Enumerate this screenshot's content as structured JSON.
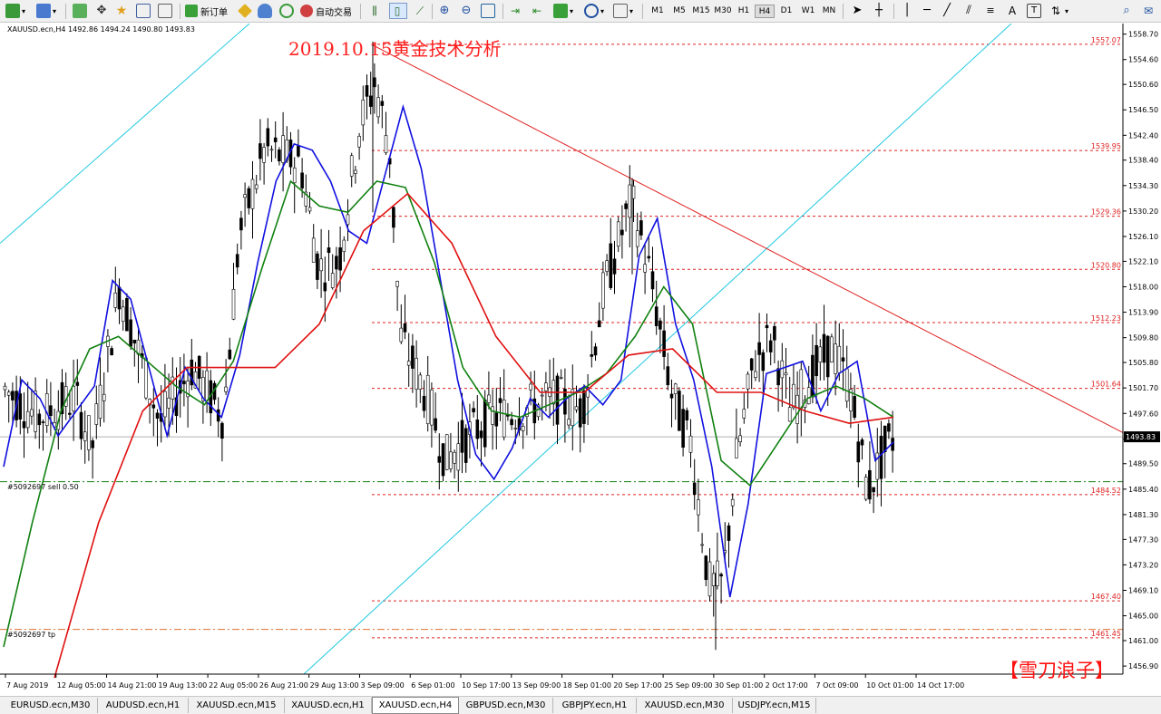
{
  "toolbar": {
    "new_order_label": "新订单",
    "auto_trading_label": "自动交易",
    "timeframes": [
      "M1",
      "M5",
      "M15",
      "M30",
      "H1",
      "H4",
      "D1",
      "W1",
      "MN"
    ],
    "active_timeframe": "H4"
  },
  "chart_header": {
    "symbol_info": "XAUUSD.ecn,H4  1492.86 1494.24 1490.80 1493.83"
  },
  "order_labels": {
    "sell_order": "#5092697 sell 0.50",
    "tp_order": "#5092697 tp"
  },
  "watermark": "【雪刀浪子】",
  "tabs": [
    "EURUSD.ecn,M30",
    "AUDUSD.ecn,H1",
    "XAUUSD.ecn,M15",
    "XAUUSD.ecn,H1",
    "XAUUSD.ecn,H4",
    "GBPUSD.ecn,M30",
    "GBPJPY.ecn,H1",
    "XAUUSD.ecn,M30",
    "USDJPY.ecn,M15"
  ],
  "active_tab": "XAUUSD.ecn,H4",
  "colors": {
    "bull_candle": "#ffffff",
    "bear_candle": "#000000",
    "ma_fast": "#1010e0",
    "ma_mid": "#108010",
    "ma_slow": "#e01010",
    "level_lines": "#e02020",
    "trend_channel": "#20c8e0",
    "resistance_trend": "#e02020",
    "order_line": "#108010",
    "tp_line": "#e07030"
  },
  "chart_data": {
    "type": "candlestick",
    "title": "2019.10.15黄金技术分析",
    "symbol": "XAUUSD.ecn",
    "timeframe": "H4",
    "last_price": 1493.83,
    "ylim": [
      1455.6,
      1560.4
    ],
    "y_ticks": [
      1558.7,
      1554.6,
      1550.6,
      1546.5,
      1542.4,
      1538.4,
      1534.3,
      1530.2,
      1526.1,
      1522.1,
      1518.0,
      1513.9,
      1509.8,
      1505.8,
      1501.7,
      1497.6,
      1493.5,
      1489.5,
      1485.4,
      1481.3,
      1477.3,
      1473.2,
      1469.1,
      1465.0,
      1461.0,
      1456.9
    ],
    "y_tick_labels": [
      "1558.70",
      "1554.60",
      "1550.60",
      "1546.50",
      "1542.40",
      "1538.40",
      "1534.30",
      "1530.20",
      "1526.10",
      "1522.10",
      "1518.00",
      "1513.90",
      "1509.80",
      "1505.80",
      "1501.70",
      "1497.60",
      "1493.50",
      "1489.50",
      "1485.40",
      "1481.30",
      "1477.30",
      "1473.20",
      "1469.10",
      "1465.00",
      "1461.00",
      "1456.90"
    ],
    "x_tick_labels": [
      "7 Aug 2019",
      "12 Aug 05:00",
      "14 Aug 21:00",
      "19 Aug 13:00",
      "22 Aug 05:00",
      "26 Aug 21:00",
      "29 Aug 13:00",
      "3 Sep 09:00",
      "6 Sep 01:00",
      "10 Sep 17:00",
      "13 Sep 09:00",
      "18 Sep 01:00",
      "20 Sep 17:00",
      "25 Sep 09:00",
      "30 Sep 01:00",
      "2 Oct 17:00",
      "7 Oct 09:00",
      "10 Oct 01:00",
      "14 Oct 17:00"
    ],
    "horizontal_levels": [
      1557.07,
      1539.95,
      1529.36,
      1520.8,
      1512.23,
      1501.64,
      1484.52,
      1467.4,
      1461.45
    ],
    "horizontal_level_labels": [
      "1557.07",
      "1539.95",
      "1529.36",
      "1520.80",
      "1512.23",
      "1501.64",
      "1484.52",
      "1467.40",
      "1461.45"
    ],
    "order_sell_price": 1486.6,
    "order_tp_price": 1462.8,
    "key_points": {
      "high": {
        "x": "3 Sep 2019",
        "y": 1557.0
      },
      "lower_high": {
        "x": "24 Sep 2019",
        "y": 1535.5
      },
      "low": {
        "x": "1 Oct 2019",
        "y": 1459.5
      },
      "last": {
        "x": "15 Oct 2019",
        "y": 1493.83
      }
    },
    "series": [
      {
        "name": "MA fast",
        "color": "#1010e0",
        "values": [
          1489.0,
          1503.0,
          1500.0,
          1494.0,
          1498.0,
          1502.0,
          1519.0,
          1516.0,
          1505.0,
          1494.0,
          1505.0,
          1500.0,
          1497.0,
          1507.0,
          1522.0,
          1535.0,
          1541.0,
          1540.0,
          1535.0,
          1527.0,
          1525.0,
          1536.0,
          1547.0,
          1537.0,
          1520.0,
          1503.0,
          1491.0,
          1487.0,
          1492.0,
          1500.0,
          1497.0,
          1500.0,
          1502.0,
          1499.0,
          1503.0,
          1523.0,
          1529.0,
          1512.0,
          1503.0,
          1489.0,
          1468.0,
          1483.0,
          1504.0,
          1505.0,
          1506.0,
          1498.0,
          1504.0,
          1506.0,
          1490.0,
          1493.0
        ]
      },
      {
        "name": "MA mid",
        "color": "#108010",
        "values": [
          1460.0,
          1480.0,
          1498.0,
          1508.0,
          1510.0,
          1506.0,
          1502.0,
          1499.0,
          1506.0,
          1521.0,
          1535.0,
          1531.0,
          1530.0,
          1535.0,
          1534.0,
          1522.0,
          1505.0,
          1498.0,
          1497.0,
          1499.0,
          1501.0,
          1504.0,
          1510.0,
          1518.0,
          1512.0,
          1490.0,
          1486.0,
          1493.0,
          1500.0,
          1502.0,
          1500.0,
          1497.0
        ]
      },
      {
        "name": "MA slow",
        "color": "#e01010",
        "values": [
          1455.0,
          1480.0,
          1498.0,
          1505.0,
          1505.0,
          1505.0,
          1512.0,
          1527.0,
          1533.0,
          1525.0,
          1510.0,
          1501.0,
          1501.0,
          1507.0,
          1508.0,
          1501.0,
          1501.0,
          1498.0,
          1496.0,
          1497.0
        ]
      }
    ]
  }
}
